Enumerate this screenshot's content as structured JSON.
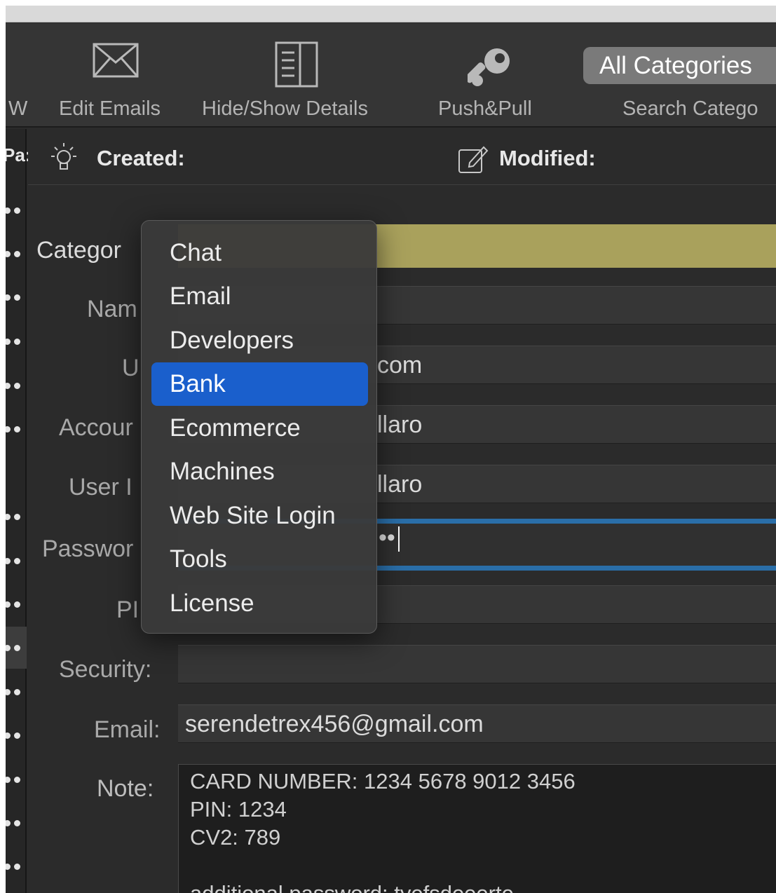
{
  "toolbar": {
    "cut_label": "W",
    "edit_emails": "Edit Emails",
    "hide_show_details": "Hide/Show Details",
    "push_pull": "Push&Pull",
    "all_categories": "All Categories",
    "search_categories": "Search Catego"
  },
  "sidebar": {
    "header_fragment": "Pa:"
  },
  "infobar": {
    "created_label": "Created:",
    "modified_label": "Modified:"
  },
  "form": {
    "category_label": "Categor",
    "name_label": "Nam",
    "url_label": "U",
    "url_value": "com",
    "account_label": "Accour",
    "account_value": "llaro",
    "userid_label": "User I",
    "userid_value": "llaro",
    "password_label": "Passwor",
    "password_value": "••",
    "pin_label": "PI",
    "security_label": "Security:",
    "email_label": "Email:",
    "email_value": "serendetrex456@gmail.com",
    "note_label": "Note:",
    "note_value": "CARD NUMBER: 1234 5678 9012 3456\nPIN: 1234\nCV2: 789\n\nadditional password: tyefsdeeerte"
  },
  "category_menu": {
    "items": [
      "Chat",
      "Email",
      "Developers",
      "Bank",
      "Ecommerce",
      "Machines",
      "Web Site Login",
      "Tools",
      "License"
    ],
    "selected": "Bank"
  },
  "colors": {
    "category_bar": "#a9a15c",
    "menu_selection": "#1a5fcc",
    "password_focus": "#2a6ea8"
  }
}
